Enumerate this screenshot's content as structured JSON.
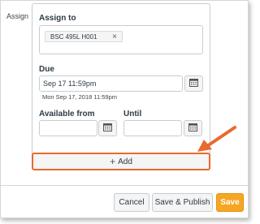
{
  "assign_label": "Assign",
  "assign_to": {
    "label": "Assign to",
    "token": "BSC 495L H001",
    "remove_glyph": "×"
  },
  "due": {
    "label": "Due",
    "value": "Sep 17 11:59pm",
    "hint": "Mon Sep 17, 2018 11:59pm"
  },
  "available_from": {
    "label": "Available from",
    "value": ""
  },
  "until": {
    "label": "Until",
    "value": ""
  },
  "add_button": {
    "icon": "+",
    "label": "Add"
  },
  "footer": {
    "cancel": "Cancel",
    "save_publish": "Save & Publish",
    "save": "Save"
  },
  "colors": {
    "highlight": "#e86a2f",
    "primary": "#f5a623"
  }
}
